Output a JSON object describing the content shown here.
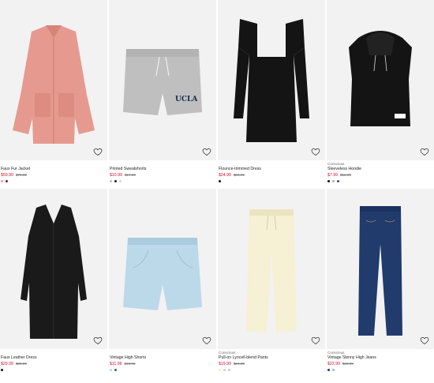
{
  "products": [
    {
      "subtitle": "",
      "title": "Faux Fur Jacket",
      "price": "$59.99",
      "old_price": "$79.99",
      "swatches": [
        "#e7a195",
        "#8a1538"
      ],
      "heart_icon": "heart-outline-icon"
    },
    {
      "subtitle": "",
      "title": "Printed Sweatshorts",
      "price": "$10.99",
      "old_price": "$17.99",
      "swatches": [
        "#bdbdbd",
        "#222222",
        "#d8cfe6"
      ],
      "heart_icon": "heart-outline-icon"
    },
    {
      "subtitle": "",
      "title": "Flounce-trimmed Dress",
      "price": "$24.99",
      "old_price": "$34.99",
      "swatches": [
        "#111111"
      ],
      "heart_icon": "heart-outline-icon"
    },
    {
      "subtitle": "Conscious",
      "title": "Sleeveless Hoodie",
      "price": "$7.99",
      "old_price": "$12.99",
      "swatches": [
        "#111111",
        "#b7a8d6",
        "#5a3a7a"
      ],
      "heart_icon": "heart-outline-icon"
    },
    {
      "subtitle": "",
      "title": "Faux Leather Dress",
      "price": "$29.99",
      "old_price": "$39.99",
      "swatches": [
        "#111111"
      ],
      "heart_icon": "heart-outline-icon"
    },
    {
      "subtitle": "",
      "title": "Vintage High Shorts",
      "price": "$11.99",
      "old_price": "$16.99",
      "swatches": [
        "#b8d8ea",
        "#3a5c94"
      ],
      "heart_icon": "heart-outline-icon"
    },
    {
      "subtitle": "Conscious",
      "title": "Pull-on Lyocell-blend Pants",
      "price": "$19.99",
      "old_price": "$24.99",
      "swatches": [
        "#f3eed2",
        "#e8c9c9",
        "#c8c8c8"
      ],
      "heart_icon": "heart-outline-icon"
    },
    {
      "subtitle": "Conscious",
      "title": "Vintage Skinny High Jeans",
      "price": "$22.99",
      "old_price": "$29.99",
      "swatches": [
        "#1f3a6b",
        "#9bb7d4"
      ],
      "heart_icon": "heart-outline-icon"
    }
  ]
}
